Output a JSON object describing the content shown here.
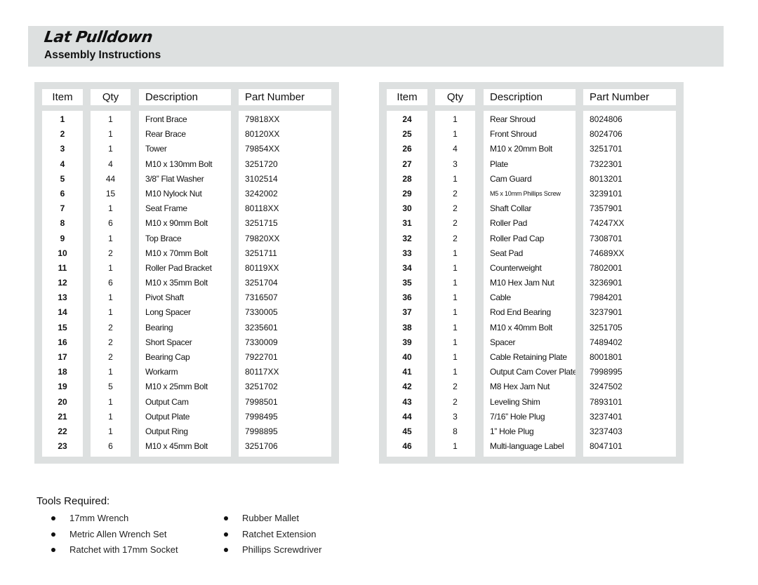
{
  "header": {
    "title": "Lat Pulldown",
    "subtitle": "Assembly Instructions"
  },
  "columns": [
    "Item",
    "Qty",
    "Description",
    "Part Number"
  ],
  "tables": [
    {
      "rows": [
        {
          "item": "1",
          "qty": "1",
          "description": "Front Brace",
          "part": "79818XX"
        },
        {
          "item": "2",
          "qty": "1",
          "description": "Rear Brace",
          "part": "80120XX"
        },
        {
          "item": "3",
          "qty": "1",
          "description": "Tower",
          "part": "79854XX"
        },
        {
          "item": "4",
          "qty": "4",
          "description": "M10 x 130mm Bolt",
          "part": "3251720"
        },
        {
          "item": "5",
          "qty": "44",
          "description": "3/8” Flat Washer",
          "part": "3102514"
        },
        {
          "item": "6",
          "qty": "15",
          "description": "M10 Nylock Nut",
          "part": "3242002"
        },
        {
          "item": "7",
          "qty": "1",
          "description": "Seat Frame",
          "part": "80118XX"
        },
        {
          "item": "8",
          "qty": "6",
          "description": "M10 x 90mm Bolt",
          "part": "3251715"
        },
        {
          "item": "9",
          "qty": "1",
          "description": "Top Brace",
          "part": "79820XX"
        },
        {
          "item": "10",
          "qty": "2",
          "description": "M10 x 70mm Bolt",
          "part": "3251711"
        },
        {
          "item": "11",
          "qty": "1",
          "description": "Roller Pad Bracket",
          "part": "80119XX"
        },
        {
          "item": "12",
          "qty": "6",
          "description": "M10 x 35mm Bolt",
          "part": "3251704"
        },
        {
          "item": "13",
          "qty": "1",
          "description": "Pivot Shaft",
          "part": "7316507"
        },
        {
          "item": "14",
          "qty": "1",
          "description": "Long Spacer",
          "part": "7330005"
        },
        {
          "item": "15",
          "qty": "2",
          "description": "Bearing",
          "part": "3235601"
        },
        {
          "item": "16",
          "qty": "2",
          "description": "Short Spacer",
          "part": "7330009"
        },
        {
          "item": "17",
          "qty": "2",
          "description": "Bearing Cap",
          "part": "7922701"
        },
        {
          "item": "18",
          "qty": "1",
          "description": "Workarm",
          "part": "80117XX"
        },
        {
          "item": "19",
          "qty": "5",
          "description": "M10 x 25mm Bolt",
          "part": "3251702"
        },
        {
          "item": "20",
          "qty": "1",
          "description": "Output Cam",
          "part": "7998501"
        },
        {
          "item": "21",
          "qty": "1",
          "description": "Output Plate",
          "part": "7998495"
        },
        {
          "item": "22",
          "qty": "1",
          "description": "Output Ring",
          "part": "7998895"
        },
        {
          "item": "23",
          "qty": "6",
          "description": "M10 x 45mm Bolt",
          "part": "3251706"
        }
      ]
    },
    {
      "rows": [
        {
          "item": "24",
          "qty": "1",
          "description": "Rear Shroud",
          "part": "8024806"
        },
        {
          "item": "25",
          "qty": "1",
          "description": "Front Shroud",
          "part": "8024706"
        },
        {
          "item": "26",
          "qty": "4",
          "description": "M10 x 20mm Bolt",
          "part": "3251701"
        },
        {
          "item": "27",
          "qty": "3",
          "description": "Plate",
          "part": "7322301"
        },
        {
          "item": "28",
          "qty": "1",
          "description": "Cam Guard",
          "part": "8013201"
        },
        {
          "item": "29",
          "qty": "2",
          "description": "M5 x 10mm Phillips Screw",
          "part": "3239101",
          "small": true
        },
        {
          "item": "30",
          "qty": "2",
          "description": "Shaft Collar",
          "part": "7357901"
        },
        {
          "item": "31",
          "qty": "2",
          "description": "Roller Pad",
          "part": "74247XX"
        },
        {
          "item": "32",
          "qty": "2",
          "description": "Roller Pad Cap",
          "part": "7308701"
        },
        {
          "item": "33",
          "qty": "1",
          "description": "Seat Pad",
          "part": "74689XX"
        },
        {
          "item": "34",
          "qty": "1",
          "description": "Counterweight",
          "part": "7802001"
        },
        {
          "item": "35",
          "qty": "1",
          "description": "M10 Hex Jam Nut",
          "part": "3236901"
        },
        {
          "item": "36",
          "qty": "1",
          "description": "Cable",
          "part": "7984201"
        },
        {
          "item": "37",
          "qty": "1",
          "description": "Rod End Bearing",
          "part": "3237901"
        },
        {
          "item": "38",
          "qty": "1",
          "description": "M10 x 40mm Bolt",
          "part": "3251705"
        },
        {
          "item": "39",
          "qty": "1",
          "description": "Spacer",
          "part": "7489402"
        },
        {
          "item": "40",
          "qty": "1",
          "description": "Cable Retaining Plate",
          "part": "8001801"
        },
        {
          "item": "41",
          "qty": "1",
          "description": "Output Cam Cover Plate",
          "part": "7998995"
        },
        {
          "item": "42",
          "qty": "2",
          "description": "M8 Hex Jam Nut",
          "part": "3247502"
        },
        {
          "item": "43",
          "qty": "2",
          "description": "Leveling Shim",
          "part": "7893101"
        },
        {
          "item": "44",
          "qty": "3",
          "description": "7/16” Hole Plug",
          "part": "3237401"
        },
        {
          "item": "45",
          "qty": "8",
          "description": "1” Hole Plug",
          "part": "3237403"
        },
        {
          "item": "46",
          "qty": "1",
          "description": "Multi-language Label",
          "part": "8047101"
        }
      ]
    }
  ],
  "tools": {
    "title": "Tools Required:",
    "columns": [
      [
        "17mm Wrench",
        "Metric Allen Wrench Set",
        "Ratchet with 17mm Socket"
      ],
      [
        "Rubber Mallet",
        "Ratchet Extension",
        "Phillips Screwdriver"
      ]
    ]
  },
  "colors": {
    "panel_gray": "#dde0e0",
    "text": "#111111"
  }
}
